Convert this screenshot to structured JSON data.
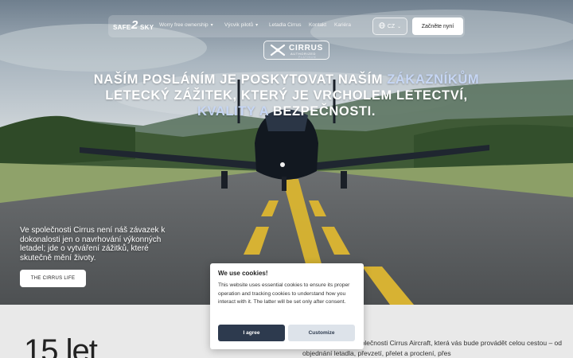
{
  "nav": {
    "logo": {
      "left": "SAFE",
      "num": "2",
      "right": "SKY"
    },
    "items": [
      {
        "label": "Worry free ownership",
        "has_dropdown": true
      },
      {
        "label": "Výcvik pilotů",
        "has_dropdown": true
      },
      {
        "label": "Letadla Cirrus",
        "has_dropdown": false
      },
      {
        "label": "Kontakt",
        "has_dropdown": false
      },
      {
        "label": "Kariéra",
        "has_dropdown": false
      }
    ],
    "language": "CZ",
    "cta": "Začněte nyní"
  },
  "badge": {
    "name": "CIRRUS",
    "sub": "AUTHORIZED",
    "tier": "PLATINUM"
  },
  "headline": {
    "part1": "Naším posláním je poskytovat naším ",
    "hl1": "zákazníkům",
    "part2": " letecký zážitek, který je vrcholem letectví, ",
    "hl2": "kvality a",
    "part3": " bezpečnosti."
  },
  "hero_text": "Ve společnosti Cirrus není náš závazek k dokonalosti jen o navrhování výkonných letadel; jde o vytváření zážitků, které skutečně mění životy.",
  "hero_button": "THE CIRRUS LIFE",
  "lower": {
    "years": "15 let",
    "text": "ovým Partnerem společnosti Cirrus Aircraft, která vás bude provádět celou cestou – od objednání letadla, převzetí, přelet a proclení, přes"
  },
  "cookie": {
    "title": "We use cookies!",
    "text": "This website uses essential cookies to ensure its proper operation and tracking cookies to understand how you interact with it. The latter will be set only after consent.",
    "accept": "I agree",
    "customize": "Customize"
  },
  "colors": {
    "accent_text": "#c6d6f4",
    "dialog_primary": "#2d3a4e",
    "dialog_secondary": "#dde3ea"
  }
}
